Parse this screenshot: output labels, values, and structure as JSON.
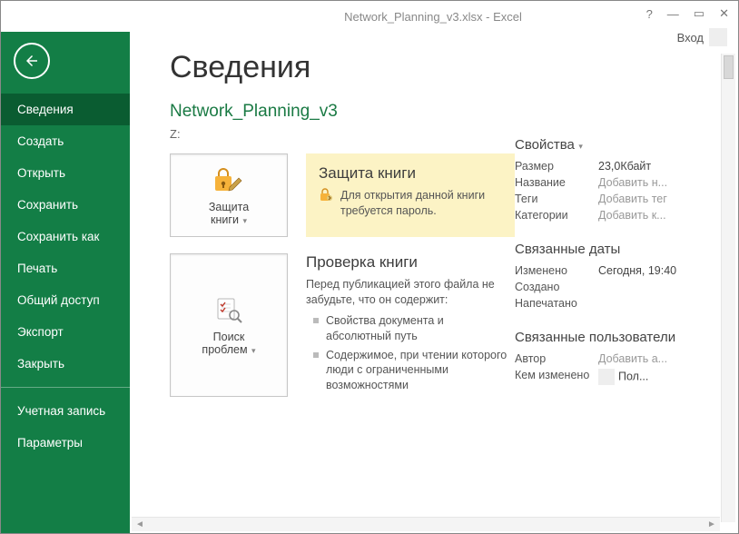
{
  "window": {
    "title": "Network_Planning_v3.xlsx - Excel",
    "login": "Вход"
  },
  "sidebar": {
    "items": [
      "Сведения",
      "Создать",
      "Открыть",
      "Сохранить",
      "Сохранить как",
      "Печать",
      "Общий доступ",
      "Экспорт",
      "Закрыть"
    ],
    "items2": [
      "Учетная запись",
      "Параметры"
    ],
    "selected_index": 0
  },
  "page": {
    "heading": "Сведения",
    "doc_title": "Network_Planning_v3",
    "doc_path": "Z:"
  },
  "protect": {
    "button_line1": "Защита",
    "button_line2": "книги",
    "title": "Защита книги",
    "desc": "Для открытия данной книги требуется пароль."
  },
  "inspect": {
    "button_line1": "Поиск",
    "button_line2": "проблем",
    "title": "Проверка книги",
    "intro": "Перед публикацией этого файла не забудьте, что он содержит:",
    "items": [
      "Свойства документа и абсолютный путь",
      "Содержимое, при чтении которого люди с ограниченными возможностями"
    ]
  },
  "props": {
    "heading": "Свойства",
    "rows": [
      {
        "label": "Размер",
        "value": "23,0Кбайт"
      },
      {
        "label": "Название",
        "placeholder": "Добавить н..."
      },
      {
        "label": "Теги",
        "placeholder": "Добавить тег"
      },
      {
        "label": "Категории",
        "placeholder": "Добавить к..."
      }
    ]
  },
  "dates": {
    "heading": "Связанные даты",
    "rows": [
      {
        "label": "Изменено",
        "value": "Сегодня, 19:40"
      },
      {
        "label": "Создано",
        "value": ""
      },
      {
        "label": "Напечатано",
        "value": ""
      }
    ]
  },
  "users": {
    "heading": "Связанные пользователи",
    "author_label": "Автор",
    "author_placeholder": "Добавить а...",
    "modified_by_label": "Кем изменено",
    "modified_by_value": "Пол..."
  }
}
